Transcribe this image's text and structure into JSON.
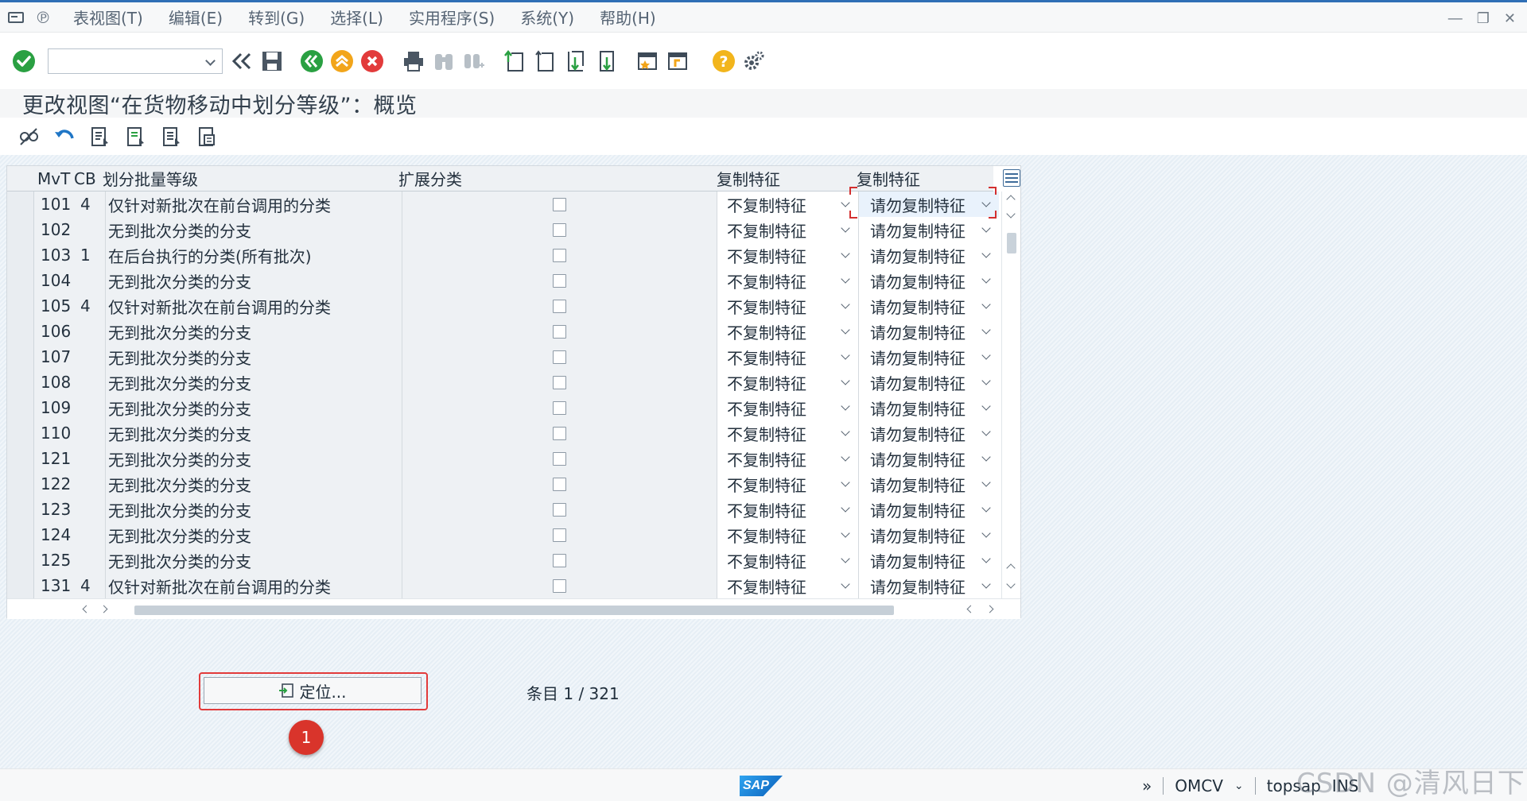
{
  "menu": {
    "items": [
      "表视图(T)",
      "编辑(E)",
      "转到(G)",
      "选择(L)",
      "实用程序(S)",
      "系统(Y)",
      "帮助(H)"
    ]
  },
  "toolbar": {
    "command_value": "",
    "icons": [
      "enter-check-icon",
      "back-double-icon",
      "save-icon",
      "back-icon",
      "exit-icon",
      "cancel-icon",
      "print-icon",
      "find-icon",
      "find-next-icon",
      "first-page-icon",
      "prev-page-icon",
      "next-page-icon",
      "last-page-icon",
      "new-session-icon",
      "shortcut-icon",
      "help-icon",
      "settings-icon"
    ],
    "colors": {
      "check": "#2aa042",
      "nav": "#2aa042",
      "exit": "#f2a51a",
      "cancel": "#e23b3b",
      "help": "#f2b51c"
    }
  },
  "title": "更改视图“在货物移动中划分等级”：概览",
  "table": {
    "headers": {
      "mvt": "MvT",
      "cb": "CB",
      "desc": "划分批量等级",
      "ext": "扩展分类",
      "copy1": "复制特征",
      "copy2": "复制特征"
    },
    "rows": [
      {
        "mvt": "101",
        "cb": "4",
        "desc": "仅针对新批次在前台调用的分类",
        "copy1": "不复制特征",
        "copy2": "请勿复制特征"
      },
      {
        "mvt": "102",
        "cb": "",
        "desc": "无到批次分类的分支",
        "copy1": "不复制特征",
        "copy2": "请勿复制特征"
      },
      {
        "mvt": "103",
        "cb": "1",
        "desc": "在后台执行的分类(所有批次)",
        "copy1": "不复制特征",
        "copy2": "请勿复制特征"
      },
      {
        "mvt": "104",
        "cb": "",
        "desc": "无到批次分类的分支",
        "copy1": "不复制特征",
        "copy2": "请勿复制特征"
      },
      {
        "mvt": "105",
        "cb": "4",
        "desc": "仅针对新批次在前台调用的分类",
        "copy1": "不复制特征",
        "copy2": "请勿复制特征"
      },
      {
        "mvt": "106",
        "cb": "",
        "desc": "无到批次分类的分支",
        "copy1": "不复制特征",
        "copy2": "请勿复制特征"
      },
      {
        "mvt": "107",
        "cb": "",
        "desc": "无到批次分类的分支",
        "copy1": "不复制特征",
        "copy2": "请勿复制特征"
      },
      {
        "mvt": "108",
        "cb": "",
        "desc": "无到批次分类的分支",
        "copy1": "不复制特征",
        "copy2": "请勿复制特征"
      },
      {
        "mvt": "109",
        "cb": "",
        "desc": "无到批次分类的分支",
        "copy1": "不复制特征",
        "copy2": "请勿复制特征"
      },
      {
        "mvt": "110",
        "cb": "",
        "desc": "无到批次分类的分支",
        "copy1": "不复制特征",
        "copy2": "请勿复制特征"
      },
      {
        "mvt": "121",
        "cb": "",
        "desc": "无到批次分类的分支",
        "copy1": "不复制特征",
        "copy2": "请勿复制特征"
      },
      {
        "mvt": "122",
        "cb": "",
        "desc": "无到批次分类的分支",
        "copy1": "不复制特征",
        "copy2": "请勿复制特征"
      },
      {
        "mvt": "123",
        "cb": "",
        "desc": "无到批次分类的分支",
        "copy1": "不复制特征",
        "copy2": "请勿复制特征"
      },
      {
        "mvt": "124",
        "cb": "",
        "desc": "无到批次分类的分支",
        "copy1": "不复制特征",
        "copy2": "请勿复制特征"
      },
      {
        "mvt": "125",
        "cb": "",
        "desc": "无到批次分类的分支",
        "copy1": "不复制特征",
        "copy2": "请勿复制特征"
      },
      {
        "mvt": "131",
        "cb": "4",
        "desc": "仅针对新批次在前台调用的分类",
        "copy1": "不复制特征",
        "copy2": "请勿复制特征"
      }
    ]
  },
  "position_button": {
    "label": "定位..."
  },
  "entry_info": "条目 1 / 321",
  "callout_badge": "1",
  "status": {
    "logo": "SAP",
    "transaction": "OMCV",
    "server": "topsap",
    "mode": "INS"
  },
  "watermark": "CSDN @清风日下"
}
